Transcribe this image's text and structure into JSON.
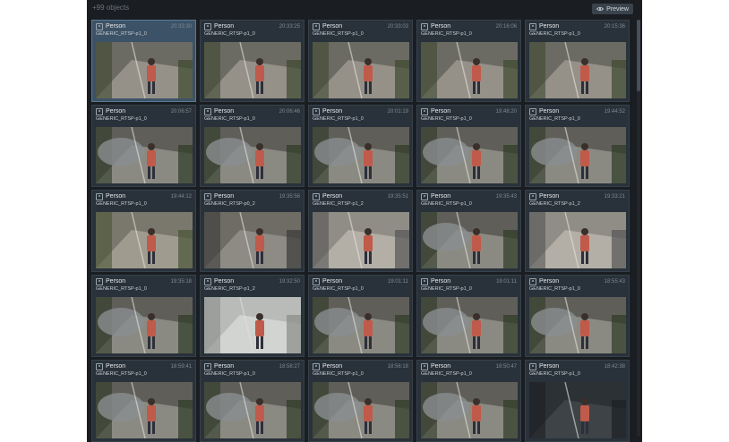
{
  "header": {
    "count_text": "+99 objects",
    "preview_label": "Preview",
    "preview_icon": "eye-icon"
  },
  "colors": {
    "panel_bg": "#1a1d21",
    "card_bg": "#29323a",
    "card_selected_bg": "#3c5266",
    "accent_button": "#3a424b"
  },
  "cards": [
    {
      "label": "Person",
      "time": "20:33:30",
      "camera": "GENERIC_RTSP-p1_0",
      "selected": true,
      "scene": "street"
    },
    {
      "label": "Person",
      "time": "20:33:25",
      "camera": "GENERIC_RTSP-p1_0",
      "selected": false,
      "scene": "street"
    },
    {
      "label": "Person",
      "time": "20:33:03",
      "camera": "GENERIC_RTSP-p1_0",
      "selected": false,
      "scene": "street"
    },
    {
      "label": "Person",
      "time": "20:16:06",
      "camera": "GENERIC_RTSP-p1_0",
      "selected": false,
      "scene": "street"
    },
    {
      "label": "Person",
      "time": "20:15:36",
      "camera": "GENERIC_RTSP-p1_0",
      "selected": false,
      "scene": "street"
    },
    {
      "label": "Person",
      "time": "20:06:57",
      "camera": "GENERIC_RTSP-p1_0",
      "selected": false,
      "scene": "car"
    },
    {
      "label": "Person",
      "time": "20:06:46",
      "camera": "GENERIC_RTSP-p1_0",
      "selected": false,
      "scene": "car"
    },
    {
      "label": "Person",
      "time": "20:01:19",
      "camera": "GENERIC_RTSP-p1_0",
      "selected": false,
      "scene": "car"
    },
    {
      "label": "Person",
      "time": "19:48:20",
      "camera": "GENERIC_RTSP-p1_0",
      "selected": false,
      "scene": "car"
    },
    {
      "label": "Person",
      "time": "19:44:52",
      "camera": "GENERIC_RTSP-p1_0",
      "selected": false,
      "scene": "car"
    },
    {
      "label": "Person",
      "time": "19:44:12",
      "camera": "GENERIC_RTSP-p1_0",
      "selected": false,
      "scene": "closeup"
    },
    {
      "label": "Person",
      "time": "19:35:56",
      "camera": "GENERIC_RTSP-p0_2",
      "selected": false,
      "scene": "door"
    },
    {
      "label": "Person",
      "time": "19:35:51",
      "camera": "GENERIC_RTSP-p1_2",
      "selected": false,
      "scene": "sidewalk"
    },
    {
      "label": "Person",
      "time": "19:35:43",
      "camera": "GENERIC_RTSP-p1_0",
      "selected": false,
      "scene": "car"
    },
    {
      "label": "Person",
      "time": "19:33:21",
      "camera": "GENERIC_RTSP-p1_2",
      "selected": false,
      "scene": "sidewalk"
    },
    {
      "label": "Person",
      "time": "19:35:18",
      "camera": "GENERIC_RTSP-p1_0",
      "selected": false,
      "scene": "car"
    },
    {
      "label": "Person",
      "time": "19:32:50",
      "camera": "GENERIC_RTSP-p1_2",
      "selected": false,
      "scene": "bright"
    },
    {
      "label": "Person",
      "time": "19:01:11",
      "camera": "GENERIC_RTSP-p1_0",
      "selected": false,
      "scene": "car"
    },
    {
      "label": "Person",
      "time": "19:01:11",
      "camera": "GENERIC_RTSP-p1_0",
      "selected": false,
      "scene": "car"
    },
    {
      "label": "Person",
      "time": "18:55:43",
      "camera": "GENERIC_RTSP-p1_0",
      "selected": false,
      "scene": "car"
    },
    {
      "label": "Person",
      "time": "18:59:41",
      "camera": "GENERIC_RTSP-p1_0",
      "selected": false,
      "scene": "car"
    },
    {
      "label": "Person",
      "time": "18:58:27",
      "camera": "GENERIC_RTSP-p1_0",
      "selected": false,
      "scene": "car"
    },
    {
      "label": "Person",
      "time": "18:56:18",
      "camera": "GENERIC_RTSP-p1_0",
      "selected": false,
      "scene": "car"
    },
    {
      "label": "Person",
      "time": "18:50:47",
      "camera": "GENERIC_RTSP-p1_0",
      "selected": false,
      "scene": "car"
    },
    {
      "label": "Person",
      "time": "18:42:38",
      "camera": "GENERIC_RTSP-p1_0",
      "selected": false,
      "scene": "dark"
    }
  ]
}
